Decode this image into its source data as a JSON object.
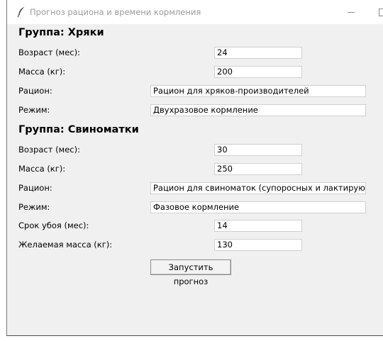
{
  "window": {
    "title": "Прогноз рациона и времени кормления",
    "icon": "feather-icon"
  },
  "groups": [
    {
      "title": "Группа: Хряки",
      "fields": [
        {
          "label": "Возраст (мес):",
          "value": "24"
        },
        {
          "label": "Масса (кг):",
          "value": "200"
        },
        {
          "label": "Рацион:",
          "value": "Рацион для хряков-производителей"
        },
        {
          "label": "Режим:",
          "value": "Двухразовое кормление"
        }
      ]
    },
    {
      "title": "Группа: Свиноматки",
      "fields": [
        {
          "label": "Возраст (мес):",
          "value": "30"
        },
        {
          "label": "Масса (кг):",
          "value": "250"
        },
        {
          "label": "Рацион:",
          "value": "Рацион для свиноматок (супоросных и лактирующих)"
        },
        {
          "label": "Режим:",
          "value": "Фазовое кормление"
        }
      ]
    }
  ],
  "slaughter": {
    "term_label": "Срок убоя (мес):",
    "term_value": "14",
    "mass_label": "Желаемая масса (кг):",
    "mass_value": "130"
  },
  "run_button": "Запустить прогноз"
}
